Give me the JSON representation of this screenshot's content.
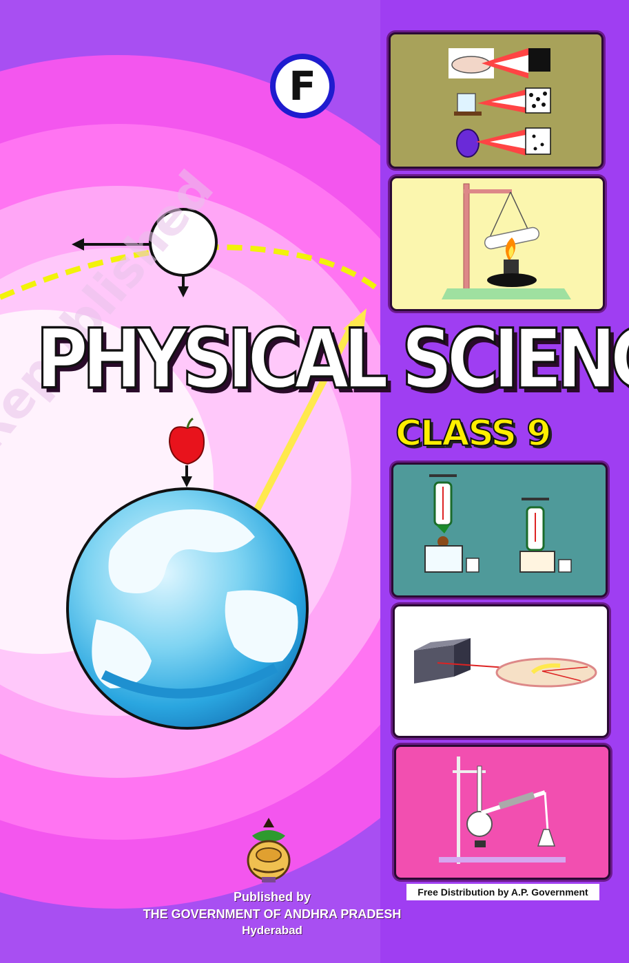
{
  "cover": {
    "badge_letter": "F",
    "title": "PHYSICAL SCIENCE",
    "subtitle": "CLASS 9",
    "free_distribution": "Free Distribution by A.P. Government",
    "publisher_line1": "Published by",
    "publisher_line2": "THE GOVERNMENT OF ANDHRA PRADESH",
    "publisher_line3": "Hyderabad",
    "watermark": "Republished"
  },
  "colors": {
    "background": "#a84ff2",
    "ring_magenta": "#ff5cf0",
    "ring_light": "#ffb0f8",
    "title_fill": "#ffffff",
    "subtitle_fill": "#ffef00",
    "badge_ring": "#1f1ccf",
    "dashed_orbit": "#f2f20a"
  },
  "panels": [
    {
      "name": "diffusion-panel",
      "bg": "#a8a25a"
    },
    {
      "name": "test-tube-heating-panel",
      "bg": "#fbf6ae"
    },
    {
      "name": "spring-balance-panel",
      "bg": "#4f9a9a"
    },
    {
      "name": "light-refraction-panel",
      "bg": "#ffffff"
    },
    {
      "name": "distillation-panel",
      "bg": "#f24fb0"
    }
  ],
  "icons": [
    "emblem-icon",
    "apple-icon",
    "globe-icon",
    "moon-icon"
  ]
}
